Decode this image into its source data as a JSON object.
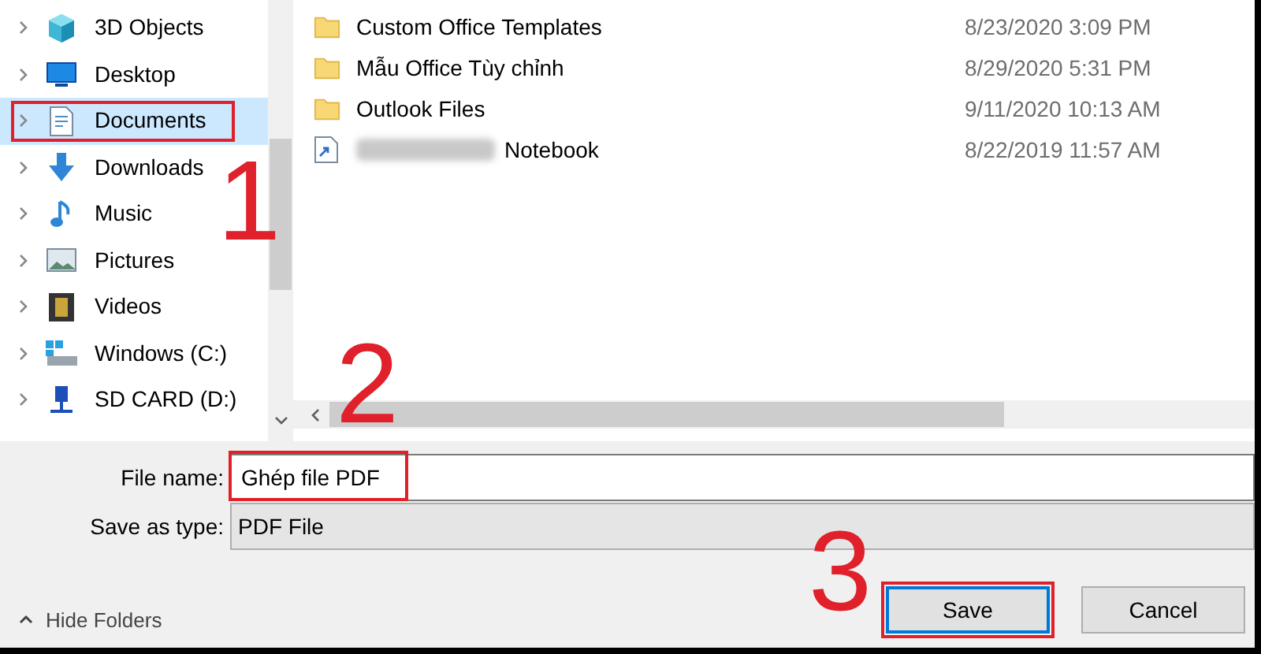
{
  "sidebar": {
    "items": [
      {
        "label": "3D Objects",
        "kind": "cube",
        "selected": false,
        "annotated": false
      },
      {
        "label": "Desktop",
        "kind": "desktop",
        "selected": false,
        "annotated": false
      },
      {
        "label": "Documents",
        "kind": "document",
        "selected": true,
        "annotated": true
      },
      {
        "label": "Downloads",
        "kind": "download",
        "selected": false,
        "annotated": false
      },
      {
        "label": "Music",
        "kind": "music",
        "selected": false,
        "annotated": false
      },
      {
        "label": "Pictures",
        "kind": "pictures",
        "selected": false,
        "annotated": false
      },
      {
        "label": "Videos",
        "kind": "videos",
        "selected": false,
        "annotated": false
      },
      {
        "label": "Windows (C:)",
        "kind": "drive",
        "selected": false,
        "annotated": false
      },
      {
        "label": "SD CARD (D:)",
        "kind": "sdcard",
        "selected": false,
        "annotated": false
      }
    ]
  },
  "files": [
    {
      "name": "Custom Office Templates",
      "date": "8/23/2020 3:09 PM",
      "kind": "folder",
      "redacted": false
    },
    {
      "name": "Mẫu Office Tùy chỉnh",
      "date": "8/29/2020 5:31 PM",
      "kind": "folder",
      "redacted": false
    },
    {
      "name": "Outlook Files",
      "date": "9/11/2020 10:13 AM",
      "kind": "folder",
      "redacted": false
    },
    {
      "name": "Notebook",
      "date": "8/22/2019 11:57 AM",
      "kind": "notebook",
      "redacted": true
    }
  ],
  "file_name": {
    "label": "File name:",
    "value": "Ghép file PDF",
    "annotated": true
  },
  "save_as_type": {
    "label": "Save as type:",
    "value": "PDF File"
  },
  "hide_folders": "Hide Folders",
  "buttons": [
    {
      "label": "Save",
      "default": true,
      "annotated": true
    },
    {
      "label": "Cancel",
      "default": false,
      "annotated": false
    }
  ],
  "annotations": [
    {
      "label": "1"
    },
    {
      "label": "2"
    },
    {
      "label": "3"
    }
  ]
}
